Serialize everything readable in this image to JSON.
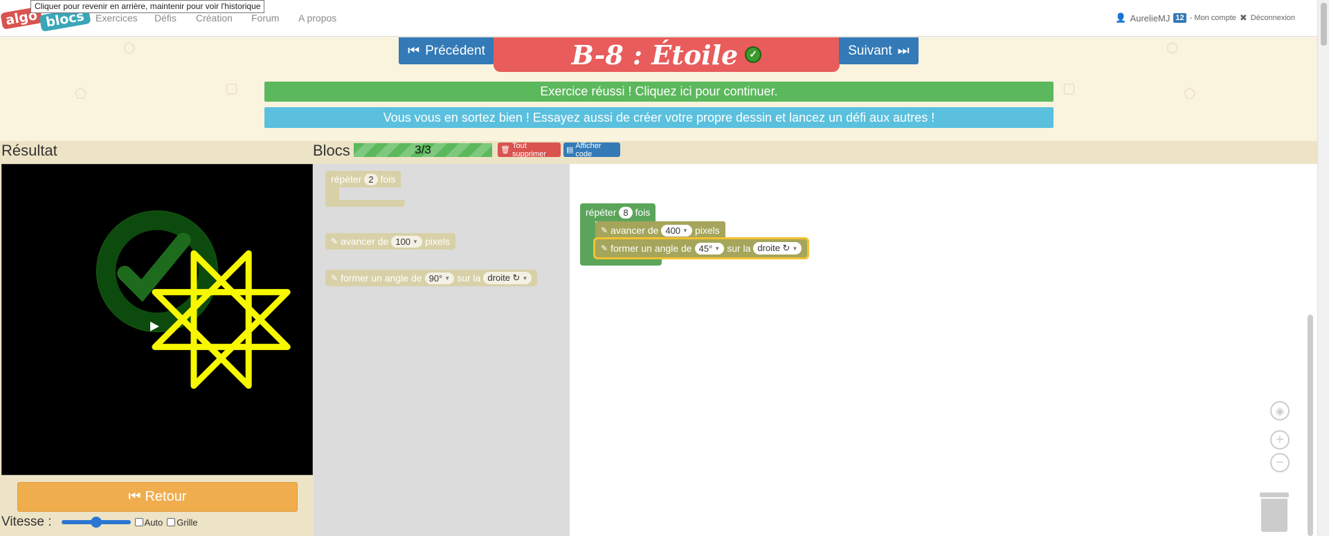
{
  "tooltip": "Cliquer pour revenir en arrière, maintenir pour voir l'historique",
  "logo": {
    "part1": "algo",
    "part2": "blocs"
  },
  "nav": {
    "items": [
      "Exercices",
      "Défis",
      "Création",
      "Forum",
      "A propos"
    ],
    "user": "AurelieMJ",
    "badge": "12",
    "account": "- Mon compte",
    "logout": "Déconnexion"
  },
  "exercise": {
    "prev": "Précédent",
    "next": "Suivant",
    "title": "B-8 : Étoile",
    "success_banner": "Exercice réussi ! Cliquez ici pour continuer.",
    "info_banner": "Vous vous en sortez bien ! Essayez aussi de créer votre propre dessin et lancez un défi aux autres !"
  },
  "result": {
    "label": "Résultat",
    "retour": "Retour",
    "speed_label": "Vitesse :",
    "speed_value": 0.5,
    "auto": "Auto",
    "grid": "Grille",
    "colors": {
      "star": "#f7f700",
      "check": "#1e6b1e"
    }
  },
  "blocks": {
    "label": "Blocs",
    "progress": "3/3",
    "delete_all": "Tout supprimer",
    "show_code": "Afficher code",
    "toolbox": {
      "repeat": {
        "prefix": "répéter",
        "value": "2",
        "suffix": "fois"
      },
      "forward": {
        "prefix": "avancer de",
        "value": "100",
        "suffix": "pixels"
      },
      "turn": {
        "prefix": "former un angle de",
        "value": "90°",
        "middle": "sur la",
        "direction": "droite ↻"
      }
    },
    "workspace": {
      "repeat": {
        "prefix": "répéter",
        "value": "8",
        "suffix": "fois"
      },
      "forward": {
        "prefix": "avancer de",
        "value": "400",
        "suffix": "pixels"
      },
      "turn": {
        "prefix": "former un angle de",
        "value": "45°",
        "middle": "sur la",
        "direction": "droite ↻"
      }
    }
  }
}
